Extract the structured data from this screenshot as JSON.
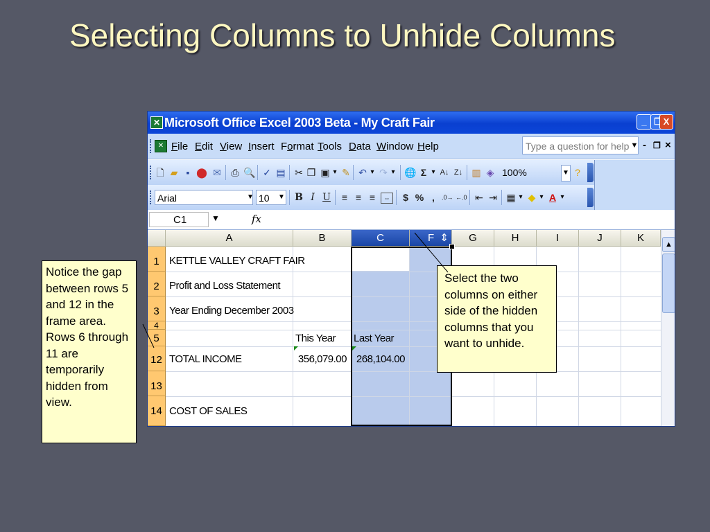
{
  "slide": {
    "title": "Selecting Columns to Unhide Columns"
  },
  "window": {
    "title": "Microsoft Office Excel 2003 Beta - My Craft Fair",
    "icon_name": "excel-icon",
    "controls": {
      "minimize": "_",
      "restore": "❐",
      "close": "X"
    }
  },
  "menu": {
    "items": [
      {
        "label": "File",
        "underline": "F"
      },
      {
        "label": "Edit",
        "underline": "E"
      },
      {
        "label": "View",
        "underline": "V"
      },
      {
        "label": "Insert",
        "underline": "I"
      },
      {
        "label": "Format",
        "underline": "o"
      },
      {
        "label": "Tools",
        "underline": "T"
      },
      {
        "label": "Data",
        "underline": "D"
      },
      {
        "label": "Window",
        "underline": "W"
      },
      {
        "label": "Help",
        "underline": "H"
      }
    ],
    "help_placeholder": "Type a question for help",
    "mdi_controls": [
      "-",
      "❐",
      "×"
    ]
  },
  "standard_toolbar": {
    "zoom": "100%"
  },
  "formatting_toolbar": {
    "font": "Arial",
    "size": "10",
    "currency": "$",
    "percent": "%",
    "comma": ","
  },
  "formula_bar": {
    "name_box": "C1",
    "fx": "fx",
    "value": ""
  },
  "sheet": {
    "columns": [
      "A",
      "B",
      "C",
      "F",
      "G",
      "H",
      "I",
      "J",
      "K"
    ],
    "selected_columns": [
      "C",
      "F"
    ],
    "active_cell": "C1",
    "row_numbers": [
      "1",
      "2",
      "3",
      "4",
      "5",
      "12",
      "13",
      "14"
    ],
    "cells": {
      "a1": "KETTLE VALLEY CRAFT FAIR",
      "a2": "Profit and Loss Statement",
      "a3": "Year Ending December 2003",
      "b5": "This Year",
      "c5": "Last Year",
      "a12": "TOTAL INCOME",
      "b12": "356,079.00",
      "c12": "268,104.00",
      "a14": "COST OF SALES"
    },
    "resize_cursor": "⇕"
  },
  "callouts": {
    "left": "Notice the gap between rows 5 and 12 in the frame area. Rows 6 through 11 are temporarily hidden from view.",
    "right": "Select the two columns on either side of the hidden columns that you want to unhide."
  },
  "colors": {
    "background": "#555866",
    "title": "#fdf7c0",
    "selection": "#b9cbec",
    "row_header": "#ffc870",
    "callout": "#ffffcc"
  }
}
